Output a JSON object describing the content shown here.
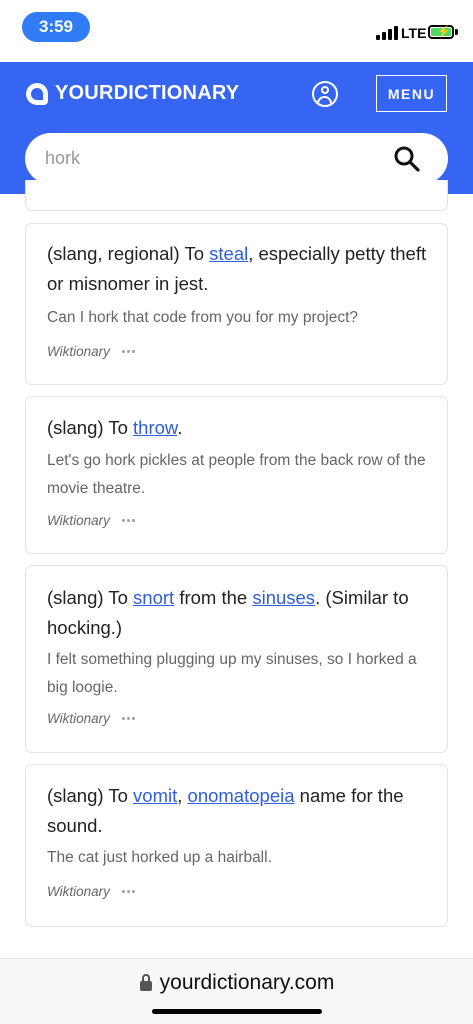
{
  "status": {
    "time": "3:59",
    "network": "LTE"
  },
  "header": {
    "logo_text": "YOURDICTIONARY",
    "menu_label": "MENU",
    "brand_color": "#3565f2"
  },
  "search": {
    "value": "hork",
    "placeholder": ""
  },
  "entries": [
    {
      "def_pre": "(slang, regional) To ",
      "link1": "steal",
      "def_post": ", especially petty theft or misnomer in jest.",
      "example": "Can I hork that code from you for my project?",
      "source": "Wiktionary"
    },
    {
      "def_pre": "(slang) To ",
      "link1": "throw",
      "def_post": ".",
      "example": "Let's go hork pickles at people from the back row of the movie theatre.",
      "source": "Wiktionary"
    },
    {
      "def_pre": "(slang) To ",
      "link1": "snort",
      "def_mid": " from the ",
      "link2": "sinuses",
      "def_post": ". (Similar to hocking.)",
      "example": "I felt something plugging up my sinuses, so I horked a big loogie.",
      "source": "Wiktionary"
    },
    {
      "def_pre": "(slang) To ",
      "link1": "vomit",
      "def_mid": ", ",
      "link2": "onomatopeia",
      "def_post": " name for the sound.",
      "example": "The cat just horked up a hairball.",
      "source": "Wiktionary"
    }
  ],
  "url_bar": {
    "domain": "yourdictionary.com"
  }
}
